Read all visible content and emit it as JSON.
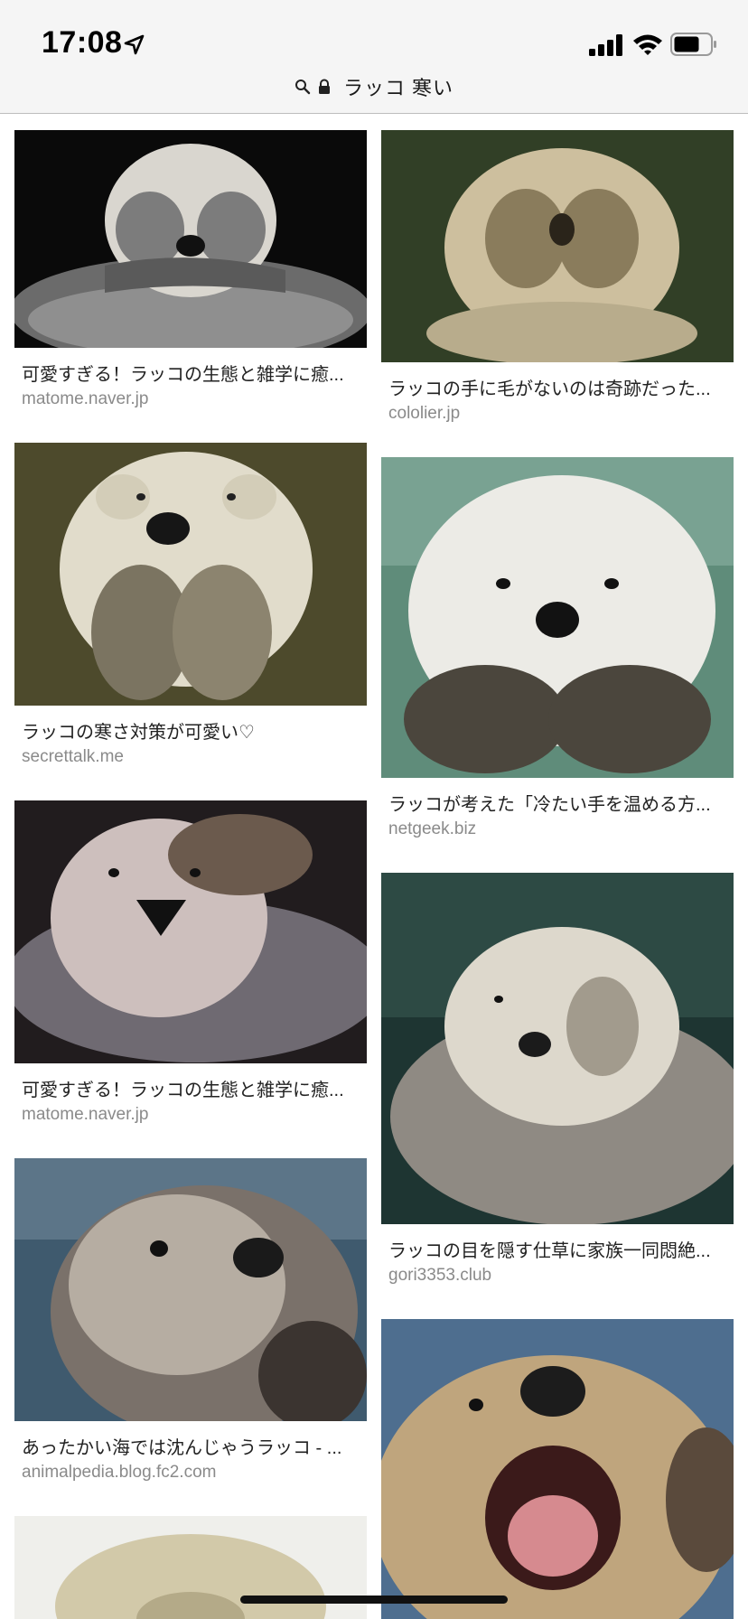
{
  "status_bar": {
    "time": "17:08",
    "icons": [
      "location-arrow-icon",
      "cellular-signal-icon",
      "wifi-icon",
      "battery-icon"
    ]
  },
  "url_bar": {
    "query": "ラッコ 寒い",
    "icons": [
      "search-icon",
      "lock-icon"
    ]
  },
  "results": [
    {
      "caption": "可愛すぎる！ラッコの生態と雑学に癒...",
      "source": "matome.naver.jp"
    },
    {
      "caption": "ラッコの手に毛がないのは奇跡だった...",
      "source": "cololier.jp"
    },
    {
      "caption": "ラッコの寒さ対策が可愛い♡",
      "source": "secrettalk.me"
    },
    {
      "caption": "ラッコが考えた「冷たい手を温める方...",
      "source": "netgeek.biz"
    },
    {
      "caption": "可愛すぎる！ラッコの生態と雑学に癒...",
      "source": "matome.naver.jp"
    },
    {
      "caption": "ラッコの目を隠す仕草に家族一同悶絶...",
      "source": "gori3353.club"
    },
    {
      "caption": "あったかい海では沈んじゃうラッコ - ...",
      "source": "animalpedia.blog.fc2.com"
    }
  ],
  "colors": {
    "status_bg": "#f5f5f5",
    "caption_text": "#222222",
    "source_text": "#8a8a8a"
  }
}
